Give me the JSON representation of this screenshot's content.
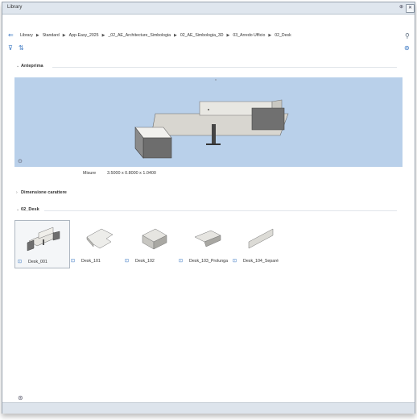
{
  "window": {
    "title": "Library",
    "pin_glyph": "⊕",
    "close_glyph": "✕"
  },
  "breadcrumb": {
    "back_icon": "⇐",
    "items": [
      "Library",
      "Standard",
      "App-Easy_2025",
      "_02_AE_Architecture_Simbologia",
      "02_AE_Simbologia_3D",
      "03_Arredo Ufficio",
      "02_Desk"
    ],
    "separator": "▶",
    "search_icon": "⚲"
  },
  "toolbar": {
    "filter_icon": "⊽",
    "sort_icon": "⇅",
    "globe_icon": "⊛"
  },
  "sections": {
    "preview": {
      "arrow": "⌄",
      "label": "Anteprima"
    },
    "dimension": {
      "arrow": "›",
      "label": "Dimensione carattere"
    },
    "folder": {
      "arrow": "⌄",
      "label": "02_Desk"
    }
  },
  "preview_icon": "⊙",
  "measure": {
    "label": "Misure",
    "value": "3.5000 x 0.8000 x 1.0400"
  },
  "items": [
    {
      "label": "Desk_001",
      "icon": "⊡"
    },
    {
      "label": "Desk_101",
      "icon": "⊡"
    },
    {
      "label": "Desk_102",
      "icon": "⊡"
    },
    {
      "label": "Desk_103_Prolunga",
      "icon": "⊡"
    },
    {
      "label": "Desk_104_Separé",
      "icon": "⊡"
    }
  ],
  "bottom_icon": "⊛",
  "colors": {
    "accent": "#3b78c3",
    "preview_bg": "#b9d0ea",
    "titlebar": "#dfe6ee"
  }
}
